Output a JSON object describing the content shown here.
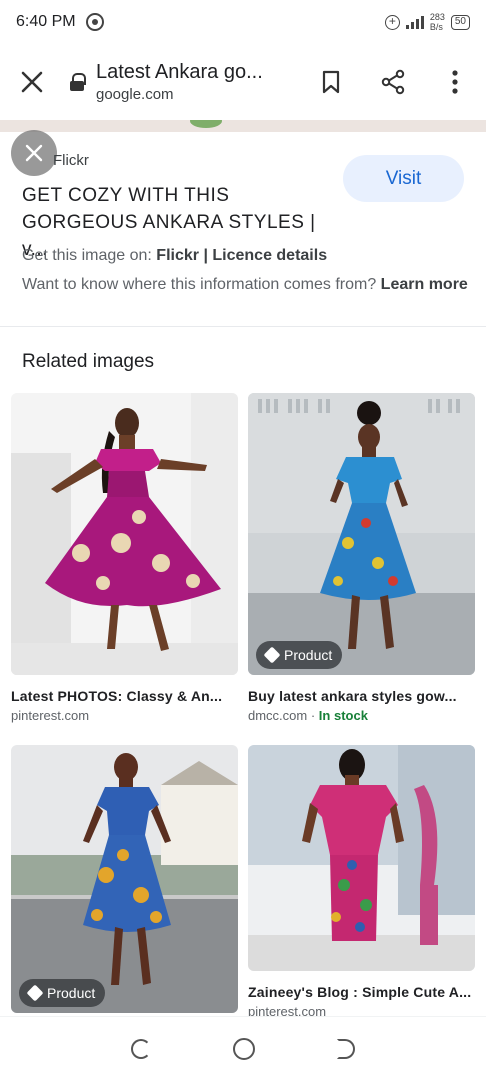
{
  "status_bar": {
    "time": "6:40 PM",
    "speed_value": "283",
    "speed_unit": "B/s",
    "battery": "50"
  },
  "toolbar": {
    "page_title": "Latest Ankara go...",
    "domain": "google.com"
  },
  "preview": {
    "source": "Flickr",
    "visit_label": "Visit",
    "headline": "GET COZY WITH THIS GORGEOUS ANKARA STYLES | v...",
    "get_image_prefix": "Get this image on:",
    "get_image_source": "Flickr",
    "separator": "|",
    "licence": "Licence details",
    "want_know": "Want to know where this information comes from?",
    "learn_more": "Learn more"
  },
  "related": {
    "heading": "Related images",
    "items": [
      {
        "title": "Latest PHOTOS: Classy & An...",
        "source": "pinterest.com",
        "stock": "",
        "tag": ""
      },
      {
        "title": "Buy latest ankara styles gow...",
        "source": "dmcc.com",
        "stock": "In stock",
        "tag": "Product"
      },
      {
        "title": "",
        "source": "",
        "stock": "",
        "tag": "Product"
      },
      {
        "title": "Zaineey's Blog : Simple Cute A...",
        "source": "pinterest.com",
        "stock": "",
        "tag": ""
      }
    ]
  },
  "colors": {
    "accent": "#1967d2",
    "visit_bg": "#e8f0fe",
    "in_stock": "#188038"
  }
}
